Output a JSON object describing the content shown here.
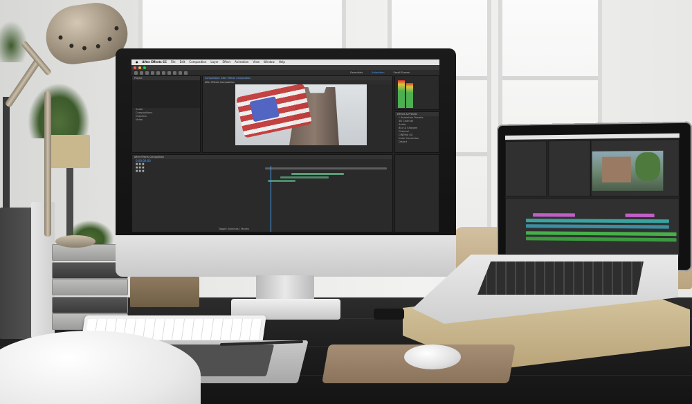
{
  "imac_screen": {
    "menubar": {
      "app_name": "After Effects CC",
      "items": [
        "File",
        "Edit",
        "Composition",
        "Layer",
        "Effect",
        "Animation",
        "View",
        "Window",
        "Help"
      ]
    },
    "workspace_tabs": [
      "Essentials",
      "Animation",
      "Small Screen"
    ],
    "project_panel": {
      "title": "Project",
      "folders": [
        "Audio",
        "Compositions",
        "Graphics",
        "Video"
      ]
    },
    "composition_panel": {
      "title": "Composition: After Effects Composition",
      "tab": "After Effects Composition"
    },
    "effects_panel": {
      "title": "Effects & Presets",
      "items": [
        "* Animation Presets",
        "3D Channel",
        "Audio",
        "Blur & Sharpen",
        "Channel",
        "CINEMA 4D",
        "Color Correction",
        "Distort"
      ]
    },
    "timeline": {
      "title": "After Effects Composition",
      "timecode": "0;00;00;00",
      "footer_label": "Toggle Switches / Modes"
    }
  },
  "colors": {
    "panel_bg": "#2a2a2a",
    "panel_header": "#333333",
    "accent_blue": "#4aa3ff",
    "timeline_track": "#5a9c78",
    "clip_magenta": "#c05fc8",
    "clip_teal": "#3aa3a0",
    "clip_green": "#46b04a"
  },
  "icons": [
    "lamp",
    "imac",
    "laptop",
    "keyboard",
    "drawing-tablet",
    "stylus-pen",
    "mouse",
    "mousepad",
    "plant",
    "books",
    "chair"
  ]
}
